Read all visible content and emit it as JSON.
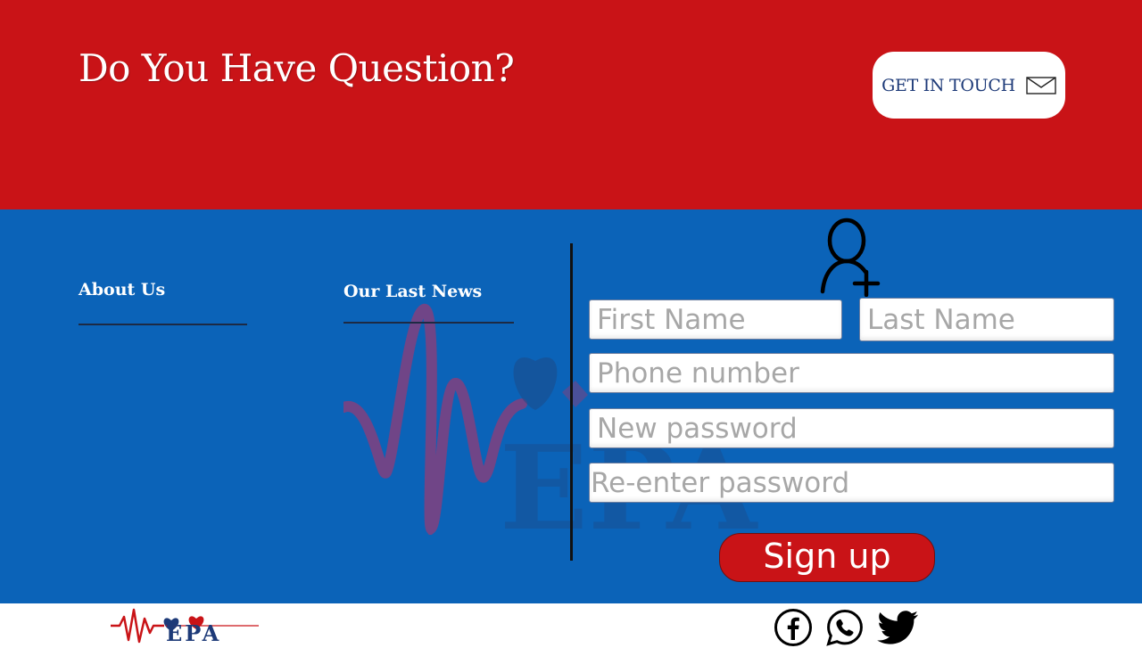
{
  "hero": {
    "title": "Do You Have Question?",
    "cta_label": "GET IN TOUCH"
  },
  "footer": {
    "about_title": "About Us",
    "news_title": "Our Last News"
  },
  "signup_form": {
    "first_name_placeholder": "First Name",
    "last_name_placeholder": "Last Name",
    "phone_placeholder": "Phone number",
    "password_placeholder": "New password",
    "confirm_password_placeholder": "Re-enter password",
    "submit_label": "Sign up"
  },
  "brand": {
    "logo_text": "EPA"
  },
  "social": [
    "facebook-icon",
    "whatsapp-icon",
    "twitter-icon"
  ],
  "colors": {
    "top_band": "#c91317",
    "blue_band": "#0b63b8",
    "brand_navy": "#1d3a78"
  }
}
